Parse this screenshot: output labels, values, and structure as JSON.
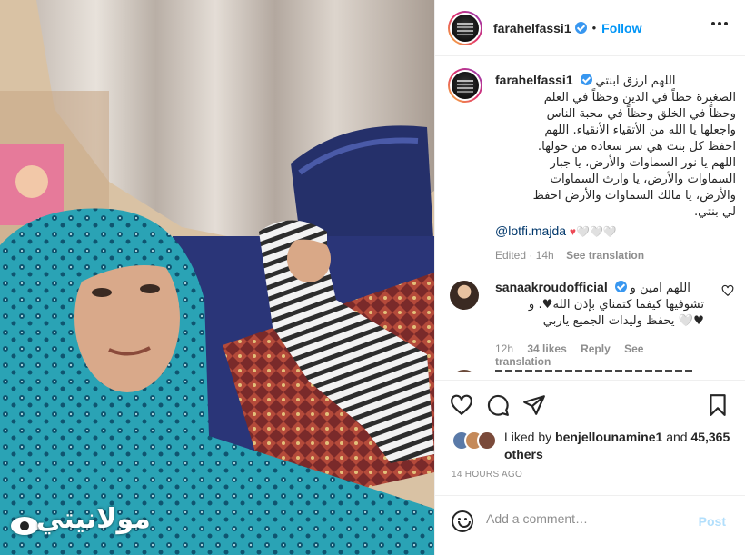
{
  "header": {
    "username": "farahelfassi1",
    "follow_label": "Follow",
    "dot": "•"
  },
  "caption": {
    "username": "farahelfassi1",
    "lines": [
      "اللهم ارزق ابنتي",
      "الصغيرة حظاً في الدين وحظاً في العلم",
      "وحظاً في الخلق وحظاً في محبة الناس",
      "واجعلها يا الله من الأتقياء الأنقياء. اللهم",
      "احفظ كل بنت هي سر سعادة من حولها.",
      "اللهم يا نور السماوات والأرض، يا جبار",
      "السماوات والأرض، يا وارث السماوات",
      "والأرض، يا مالك السماوات والأرض احفظ",
      "لي بنتي."
    ],
    "mention": "@lotfi.majda",
    "hearts": "♥🤍🤍🤍",
    "edited": "Edited · 14h",
    "see_translation": "See translation"
  },
  "comment": {
    "username": "sanaakroudofficial",
    "lines": [
      "اللهم امين و",
      "تشوفيها كيفما كتمناي بإذن الله♥. و",
      "♥🤍 يحفظ وليدات الجميع ياربي"
    ],
    "time": "12h",
    "likes": "34 likes",
    "reply": "Reply",
    "see_translation": "See translation"
  },
  "likes": {
    "prefix": "Liked by",
    "user": "benjellounamine1",
    "middle": "and",
    "count": "45,365",
    "suffix": "others"
  },
  "timestamp": "14 HOURS AGO",
  "add_comment": {
    "placeholder": "Add a comment…",
    "post_label": "Post"
  },
  "watermark": {
    "text": "مولانيتي"
  },
  "colors": {
    "link": "#0095f6",
    "verified": "#3897f0",
    "mention": "#00376b",
    "heart": "#ed4956",
    "muted": "#8e8e8e",
    "post_disabled": "#b2dffc"
  },
  "icons": [
    "heart-icon",
    "comment-icon",
    "share-icon",
    "bookmark-icon",
    "emoji-icon",
    "more-options-icon",
    "verified-icon"
  ]
}
